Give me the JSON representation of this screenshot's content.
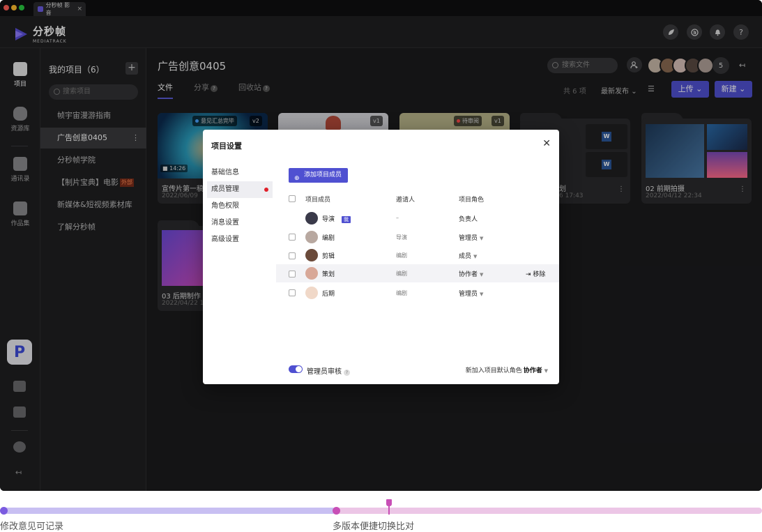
{
  "window": {
    "tab_title": "分秒帧 影音",
    "tab_close": "×"
  },
  "header": {
    "logo_text": "分秒帧",
    "logo_sub": "MEDIATRACK",
    "icons": [
      "leaf-icon",
      "stats-icon",
      "bell-icon",
      "help-icon"
    ],
    "help_label": "?"
  },
  "rail": {
    "items": [
      {
        "label": "项目",
        "icon": "project-icon",
        "active": true
      },
      {
        "label": "资源库",
        "icon": "library-icon",
        "active": false
      },
      {
        "label": "通讯录",
        "icon": "contacts-icon",
        "active": false
      },
      {
        "label": "作品集",
        "icon": "portfolio-icon",
        "active": false
      }
    ],
    "collapse": "↤"
  },
  "projects": {
    "title": "我的项目（6）",
    "add": "+",
    "search_placeholder": "搜索项目",
    "items": [
      {
        "label": "帧宇宙漫游指南",
        "active": false
      },
      {
        "label": "广告创意0405",
        "active": true
      },
      {
        "label": "分秒帧学院",
        "active": false
      },
      {
        "label": "【制片宝典】电影",
        "tag": "外部",
        "active": false
      },
      {
        "label": "新媒体&短视频素材库",
        "active": false
      },
      {
        "label": "了解分秒帧",
        "active": false
      }
    ],
    "more": "⋮"
  },
  "main": {
    "title": "广告创意0405",
    "search_placeholder": "搜索文件",
    "member_count": "5",
    "collapse": "↤",
    "tabs": [
      {
        "label": "文件",
        "active": true,
        "help": false
      },
      {
        "label": "分享",
        "active": false,
        "help": true
      },
      {
        "label": "回收站",
        "active": false,
        "help": true
      }
    ],
    "count": "共 6 项",
    "sort": "最新发布",
    "upload": "上传",
    "new": "新建",
    "cards": [
      {
        "caption": "宣传片第一稿",
        "date": "2022/06/09",
        "badge": "意见汇总完毕",
        "version": "v2",
        "duration": "14:26"
      },
      {
        "caption": "",
        "date": "",
        "version": "v1"
      },
      {
        "caption": "",
        "date": "",
        "badge": "待审阅",
        "version": "v1"
      },
      {
        "caption": "划",
        "date": "6 17:43"
      },
      {
        "caption": "02 前期拍摄",
        "date": "2022/04/12 22:34"
      },
      {
        "caption": "03 后期制作",
        "date": "2022/04/22 1"
      }
    ],
    "word_letter": "W",
    "kebab": "⋮"
  },
  "modal": {
    "title": "项目设置",
    "close": "✕",
    "nav": [
      {
        "label": "基础信息",
        "active": false,
        "dot": false
      },
      {
        "label": "成员管理",
        "active": true,
        "dot": true
      },
      {
        "label": "角色权限",
        "active": false,
        "dot": false
      },
      {
        "label": "消息设置",
        "active": false,
        "dot": false
      },
      {
        "label": "高级设置",
        "active": false,
        "dot": false
      }
    ],
    "add_member": "添加项目成员",
    "columns": {
      "member": "项目成员",
      "inviter": "邀请人",
      "role": "项目角色"
    },
    "members": [
      {
        "name": "导演",
        "me": "我",
        "inviter": "–",
        "role": "负责人",
        "dropdown": false,
        "checkbox": false
      },
      {
        "name": "编剧",
        "inviter": "导演",
        "role": "管理员",
        "dropdown": true,
        "checkbox": true
      },
      {
        "name": "剪辑",
        "inviter": "编剧",
        "role": "成员",
        "dropdown": true,
        "checkbox": true
      },
      {
        "name": "策划",
        "inviter": "编剧",
        "role": "协作者",
        "dropdown": true,
        "checkbox": true,
        "remove": "移除"
      },
      {
        "name": "后期",
        "inviter": "编剧",
        "role": "管理员",
        "dropdown": true,
        "checkbox": true
      }
    ],
    "admin_review": "管理员审核",
    "admin_review_on": true,
    "default_role_label": "新加入项目默认角色",
    "default_role_value": "协作者"
  },
  "timeline": {
    "labels": [
      "修改意见可记录",
      "多版本便捷切换比对"
    ],
    "colors": {
      "start": "#7b5be0",
      "end": "#c84fb6"
    }
  }
}
